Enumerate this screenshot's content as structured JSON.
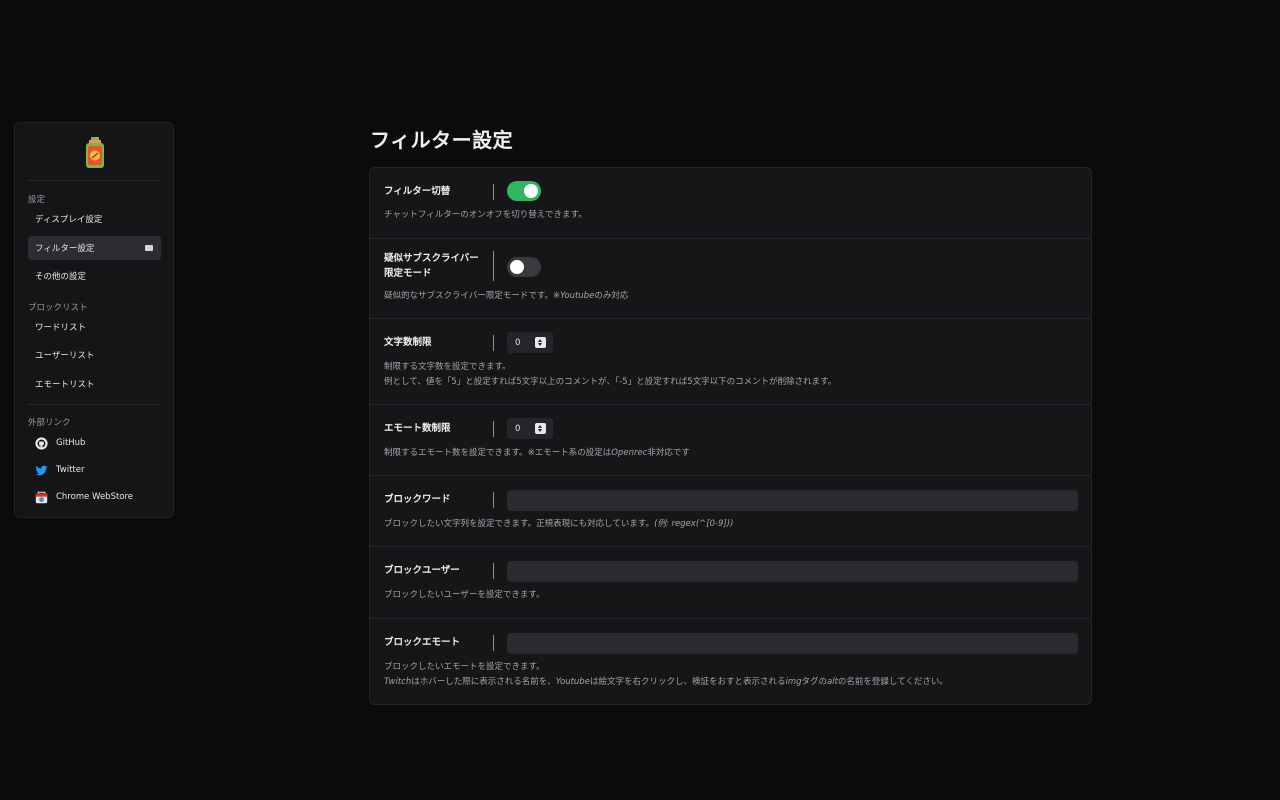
{
  "sidebar": {
    "logo_icon": "battery-logo-icon",
    "sections": {
      "settings": "設定",
      "blocklist": "ブロックリスト",
      "external": "外部リンク"
    },
    "items": [
      {
        "label": "ディスプレイ設定",
        "active": false
      },
      {
        "label": "フィルター設定",
        "active": true
      },
      {
        "label": "その他の設定",
        "active": false
      },
      {
        "label": "ワードリスト",
        "active": false
      },
      {
        "label": "ユーザーリスト",
        "active": false
      },
      {
        "label": "エモートリスト",
        "active": false
      }
    ],
    "links": [
      {
        "label": "GitHub",
        "icon": "github-icon"
      },
      {
        "label": "Twitter",
        "icon": "twitter-icon"
      },
      {
        "label": "Chrome WebStore",
        "icon": "chrome-webstore-icon"
      }
    ]
  },
  "page": {
    "title": "フィルター設定"
  },
  "settings": {
    "filter_toggle": {
      "label": "フィルター切替",
      "enabled": true,
      "desc": "チャットフィルターのオンオフを切り替えできます。"
    },
    "pseudo_sub": {
      "label_line1": "疑似サブスクライバー",
      "label_line2": "限定モード",
      "enabled": false,
      "desc_prefix": "疑似的なサブスクライバー限定モードです。※",
      "desc_em": "Youtube",
      "desc_suffix": "のみ対応"
    },
    "char_limit": {
      "label": "文字数制限",
      "value": "0",
      "desc_line1": "制限する文字数を設定できます。",
      "desc_line2": "例として、値を「5」と設定すれば5文字以上のコメントが、「-5」と設定すれば5文字以下のコメントが削除されます。"
    },
    "emote_limit": {
      "label": "エモート数制限",
      "value": "0",
      "desc_prefix": "制限するエモート数を設定できます。※エモート系の設定は",
      "desc_em": "Openrec",
      "desc_suffix": "非対応です"
    },
    "block_word": {
      "label": "ブロックワード",
      "value": "",
      "desc_prefix": "ブロックしたい文字列を設定できます。正規表現にも対応しています。",
      "desc_em": "(例: regex(^[0-9]))"
    },
    "block_user": {
      "label": "ブロックユーザー",
      "value": "",
      "desc": "ブロックしたいユーザーを設定できます。"
    },
    "block_emote": {
      "label": "ブロックエモート",
      "value": "",
      "desc_line1": "ブロックしたいエモートを設定できます。",
      "desc_line2_em1": "Twitch",
      "desc_line2_a": "はホバーした際に表示される名前を、",
      "desc_line2_em2": "Youtube",
      "desc_line2_b": "は絵文字を右クリックし、検証をおすと表示される",
      "desc_line2_em3": "img",
      "desc_line2_c": "タグの",
      "desc_line2_em4": "alt",
      "desc_line2_d": "の名前を登録してください。"
    }
  },
  "colors": {
    "toggle_on": "#2fb65f",
    "background": "#0b0b0c",
    "panel": "#161618"
  }
}
